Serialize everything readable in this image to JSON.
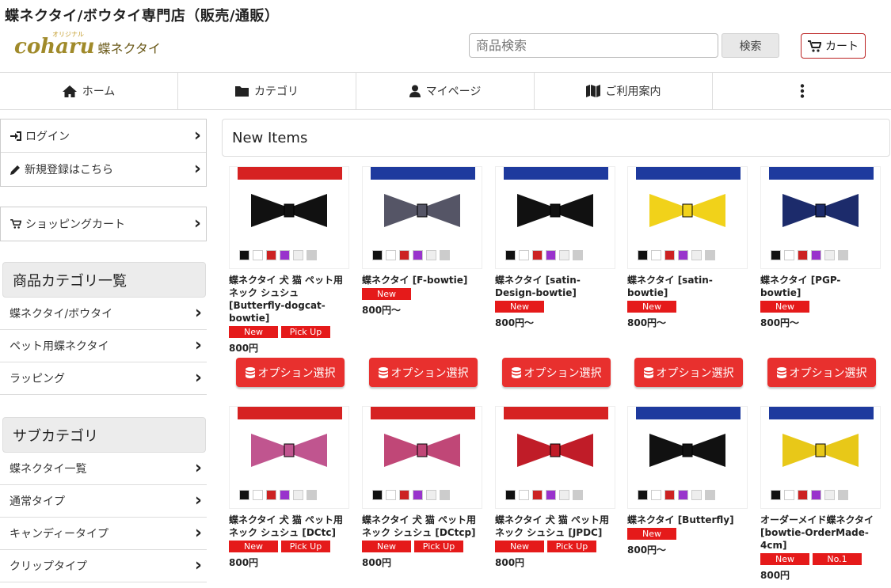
{
  "site_title": "蝶ネクタイ/ボウタイ専門店（販売/通販）",
  "logo": {
    "main": "coharu",
    "sub": "蝶ネクタイ",
    "tag": "オリジナル"
  },
  "search": {
    "placeholder": "商品検索",
    "button": "検索"
  },
  "cart": {
    "label": "カート"
  },
  "nav": [
    {
      "label": "ホーム",
      "icon": "home-icon"
    },
    {
      "label": "カテゴリ",
      "icon": "folder-icon"
    },
    {
      "label": "マイページ",
      "icon": "user-icon"
    },
    {
      "label": "ご利用案内",
      "icon": "map-icon"
    },
    {
      "label": "",
      "icon": "more-vertical-icon"
    }
  ],
  "sidebar": {
    "account": [
      {
        "label": "ログイン",
        "icon": "sign-in-icon"
      },
      {
        "label": "新規登録はこちら",
        "icon": "pencil-icon"
      }
    ],
    "cart": {
      "label": "ショッピングカート",
      "icon": "cart-icon"
    },
    "categories_title": "商品カテゴリ一覧",
    "categories": [
      {
        "label": "蝶ネクタイ/ボウタイ"
      },
      {
        "label": "ペット用蝶ネクタイ"
      },
      {
        "label": "ラッピング"
      }
    ],
    "subcategories_title": "サブカテゴリ",
    "subcategories": [
      {
        "label": "蝶ネクタイ一覧"
      },
      {
        "label": "通常タイプ"
      },
      {
        "label": "キャンディータイプ"
      },
      {
        "label": "クリップタイプ"
      }
    ]
  },
  "main": {
    "heading": "New Items",
    "option_button": "オプション選択",
    "items": [
      {
        "name": "蝶ネクタイ 犬 猫 ペット用 ネック シュシュ [Butterfly-dogcat-bowtie]",
        "badges": [
          "New",
          "Pick Up"
        ],
        "price": "800円"
      },
      {
        "name": "蝶ネクタイ [F-bowtie]",
        "badges": [
          "New"
        ],
        "price": "800円～"
      },
      {
        "name": "蝶ネクタイ [satin-Design-bowtie]",
        "badges": [
          "New"
        ],
        "price": "800円～"
      },
      {
        "name": "蝶ネクタイ [satin-bowtie]",
        "badges": [
          "New"
        ],
        "price": "800円～"
      },
      {
        "name": "蝶ネクタイ [PGP-bowtie]",
        "badges": [
          "New"
        ],
        "price": "800円～"
      },
      {
        "name": "蝶ネクタイ 犬 猫 ペット用 ネック シュシュ [DCtc]",
        "badges": [
          "New",
          "Pick Up"
        ],
        "price": "800円"
      },
      {
        "name": "蝶ネクタイ 犬 猫 ペット用 ネック シュシュ [DCtcp]",
        "badges": [
          "New",
          "Pick Up"
        ],
        "price": "800円"
      },
      {
        "name": "蝶ネクタイ 犬 猫 ペット用 ネック シュシュ [JPDC]",
        "badges": [
          "New",
          "Pick Up"
        ],
        "price": "800円"
      },
      {
        "name": "蝶ネクタイ [Butterfly]",
        "badges": [
          "New"
        ],
        "price": "800円～"
      },
      {
        "name": "オーダーメイド蝶ネクタイ [bowtie-OrderMade-4cm]",
        "badges": [
          "New",
          "No.1"
        ],
        "price": "800円"
      }
    ]
  },
  "colors": {
    "accent_red": "#e51a1a",
    "button_red": "#e8302e",
    "logo_gold": "#a08a2a"
  }
}
